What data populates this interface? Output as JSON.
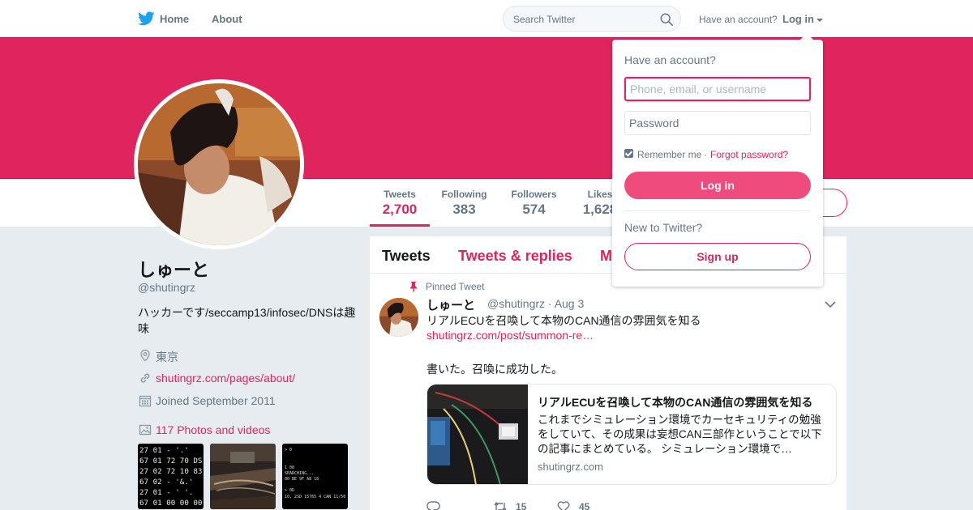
{
  "nav": {
    "home": "Home",
    "about": "About",
    "search_placeholder": "Search Twitter",
    "have_account": "Have an account?",
    "login": "Log in"
  },
  "profile": {
    "name": "しゅーと",
    "handle": "@shutingrz",
    "bio": "ハッカーです/seccamp13/infosec/DNSは趣味",
    "location": "東京",
    "website": "shutingrz.com/pages/about/",
    "joined": "Joined September 2011",
    "photos": "117 Photos and videos",
    "media_thumbs": [
      {
        "lines": [
          "27 01  -  '.'",
          "67 01 72 70 DS",
          "27 02 72 10 83",
          "67 02  -  '&.'",
          "27 01  -  ' '.",
          "67 01 00 00 00"
        ]
      },
      {
        "lines": []
      },
      {
        "lines": [
          "> 0",
          "",
          "1 00",
          "SEARCHING...",
          "00 BE 9F A8 18",
          "",
          "> 0D",
          "10, 2SD 15765 4 CAN 11/50"
        ]
      }
    ]
  },
  "stats": [
    {
      "label": "Tweets",
      "value": "2,700",
      "active": true
    },
    {
      "label": "Following",
      "value": "383"
    },
    {
      "label": "Followers",
      "value": "574"
    },
    {
      "label": "Likes",
      "value": "1,628"
    }
  ],
  "timeline": {
    "tabs": [
      "Tweets",
      "Tweets & replies",
      "Media"
    ],
    "pinned_label": "Pinned Tweet",
    "tweet": {
      "name": "しゅーと",
      "meta": "@shutingrz · Aug 3",
      "text": "リアルECUを召喚して本物のCAN通信の雰囲気を知る",
      "link": "shutingrz.com/post/summon-re…",
      "text2": "書いた。召喚に成功した。",
      "card": {
        "title": "リアルECUを召喚して本物のCAN通信の雰囲気を知る",
        "description": "これまでシミュレーション環境でカーセキュリティの勉強をしていて、その成果は妄想CAN三部作ということで以下の記事にまとめている。 シミュレーション環境で…",
        "domain": "shutingrz.com"
      },
      "retweets": "15",
      "likes": "45"
    }
  },
  "login_dropdown": {
    "heading": "Have an account?",
    "username_placeholder": "Phone, email, or username",
    "password_placeholder": "Password",
    "remember": "Remember me",
    "separator": "·",
    "forgot": "Forgot password?",
    "login_button": "Log in",
    "new_to_twitter": "New to Twitter?",
    "signup_button": "Sign up"
  },
  "colors": {
    "accent": "#e0245e",
    "login_button": "#ef4b7d",
    "nav_text": "#66757f",
    "background": "#e6ecf0"
  }
}
